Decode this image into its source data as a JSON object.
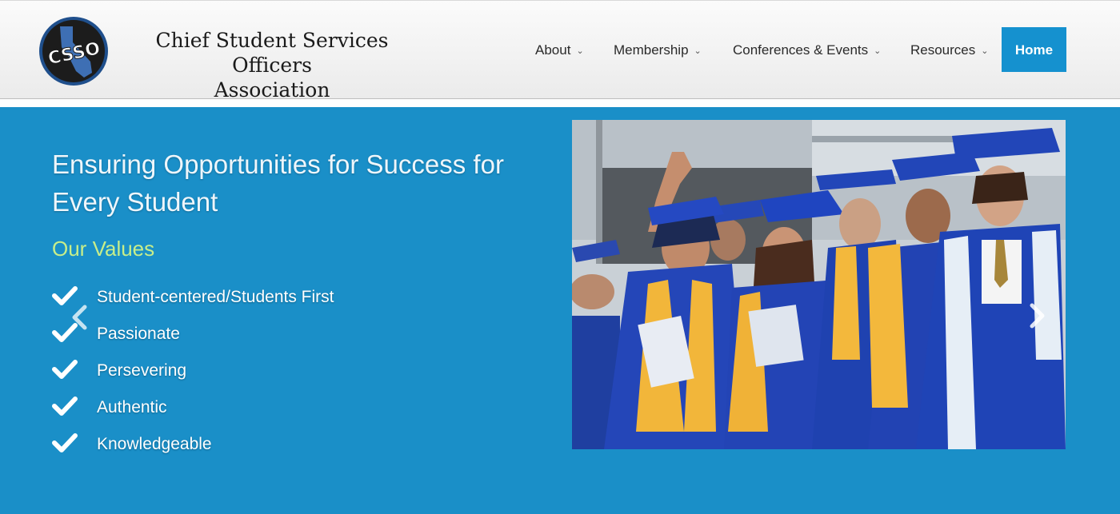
{
  "header": {
    "logo_text": "CSSO",
    "site_name_line1": "Chief Student Services Officers",
    "site_name_line2": "Association"
  },
  "nav": {
    "items": [
      {
        "label": "About",
        "chevron": "chevron-down-icon"
      },
      {
        "label": "Membership",
        "chevron": "chevron-down-icon"
      },
      {
        "label": "Conferences & Events",
        "chevron": "chevron-down-icon"
      },
      {
        "label": "Resources",
        "chevron": "chevron-down-icon"
      }
    ],
    "home_label": "Home"
  },
  "hero": {
    "headline": "Ensuring Opportunities for Success for Every Student",
    "values_title": "Our Values",
    "values": [
      "Student-centered/Students First",
      "Passionate",
      "Persevering",
      "Authentic",
      "Knowledgeable"
    ],
    "slider_prev_icon": "chevron-left-icon",
    "slider_next_icon": "chevron-right-icon",
    "photo_subject": "graduation-photo"
  },
  "colors": {
    "brand_blue": "#1a8fc8",
    "home_button": "#1591cf",
    "values_title": "#c7ee8a",
    "logo_ring": "#1f4f8c"
  }
}
